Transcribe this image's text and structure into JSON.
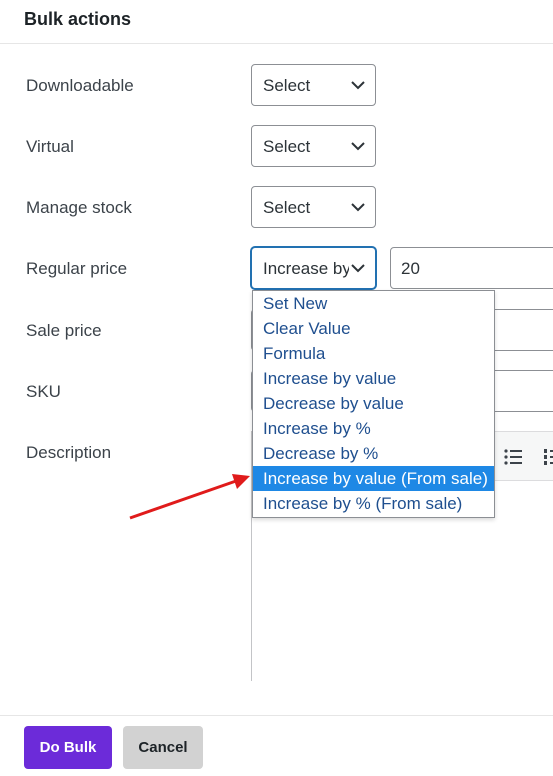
{
  "dialog": {
    "title": "Bulk actions"
  },
  "rows": {
    "downloadable": {
      "label": "Downloadable",
      "value": "Select"
    },
    "virtual": {
      "label": "Virtual",
      "value": "Select"
    },
    "manage_stock": {
      "label": "Manage stock",
      "value": "Select"
    },
    "regular_price": {
      "label": "Regular price",
      "operation": "Increase by value (From sale)",
      "amount": "20"
    },
    "sale_price": {
      "label": "Sale price"
    },
    "sku": {
      "label": "SKU"
    },
    "description": {
      "label": "Description"
    }
  },
  "dropdown": {
    "options": [
      "Set New",
      "Clear Value",
      "Formula",
      "Increase by value",
      "Decrease by value",
      "Increase by %",
      "Decrease by %",
      "Increase by value (From sale)",
      "Increase by % (From sale)"
    ],
    "selected_index": 7
  },
  "footer": {
    "do_bulk_label": "Do Bulk",
    "cancel_label": "Cancel"
  },
  "colors": {
    "primary": "#6c2bd9",
    "highlight": "#1e88e5",
    "annotation_arrow": "#e01b1b"
  }
}
